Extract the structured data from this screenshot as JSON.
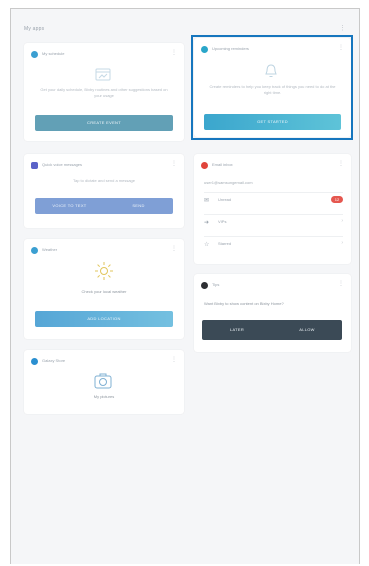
{
  "screen": {
    "title": "My apps",
    "more_icon": "kebab-menu-icon"
  },
  "cards": {
    "my_schedule": {
      "title": "My schedule",
      "accent": "#3b9fd1",
      "icon": "calendar-icon",
      "description": "Get your daily schedule, Bixby routines and other suggestions based on your usage",
      "button": "CREATE EVENT"
    },
    "reminder": {
      "title": "Upcoming reminders",
      "accent": "#2aa6c9",
      "icon": "bell-icon",
      "description": "Create reminders to help you keep track of things you need to do at the right time.",
      "button": "GET STARTED"
    },
    "quick_message": {
      "title": "Quick voice messages",
      "accent": "#5a62c8",
      "description": "Tap to dictate and send a message",
      "buttons": [
        "VOICE TO TEXT",
        "SEND"
      ]
    },
    "email": {
      "title": "Email inbox",
      "accent": "#e0443b",
      "account": "user1@samsungemail.com",
      "rows": [
        {
          "icon": "inbox-icon",
          "label": "Unread",
          "badge": "12"
        },
        {
          "icon": "sent-icon",
          "label": "VIPs",
          "chevron": "›"
        },
        {
          "icon": "star-icon",
          "label": "Starred",
          "chevron": "›"
        }
      ]
    },
    "weather": {
      "title": "Weather",
      "accent": "#3b9fd1",
      "icon": "sun-icon",
      "description": "Check your local weather",
      "button": "ADD LOCATION"
    },
    "bixby_tips": {
      "title": "Tips",
      "accent": "#2d2f33",
      "question": "Want Bixby to show content on Bixby Home?",
      "buttons": [
        "LATER",
        "ALLOW"
      ]
    },
    "galaxy_shop": {
      "title": "Galaxy Store",
      "accent": "#2a8fd0",
      "icon": "camera-icon",
      "caption": "My pictures"
    }
  }
}
